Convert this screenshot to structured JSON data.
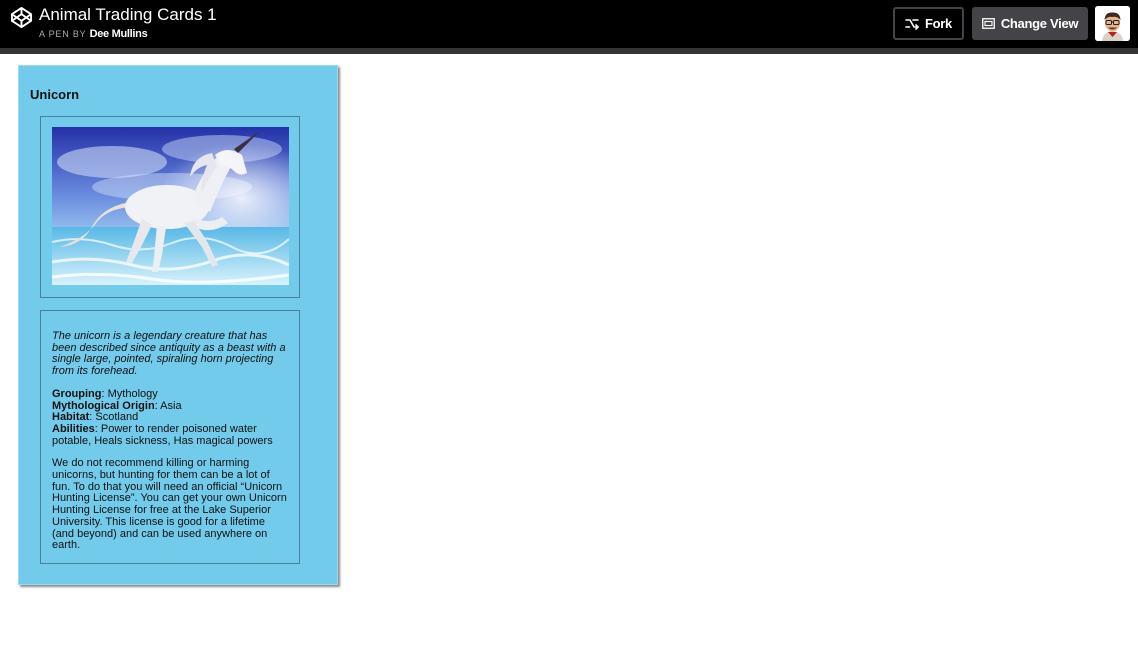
{
  "header": {
    "title": "Animal Trading Cards 1",
    "byline_prefix": "A PEN BY",
    "author": "Dee Mullins",
    "logo_icon": "codepen-logo-icon",
    "fork_label": "Fork",
    "fork_icon": "fork-icon",
    "change_view_label": "Change View",
    "change_view_icon": "layout-icon",
    "avatar_icon": "user-avatar"
  },
  "card": {
    "title": "Unicorn",
    "image_icon": "unicorn-photo",
    "intro": "The unicorn is a legendary creature that has been described since antiquity as a beast with a single large, pointed, spiraling horn projecting from its forehead.",
    "facts": [
      {
        "label": "Grouping",
        "value": ": Mythology"
      },
      {
        "label": "Mythological Origin",
        "value": ": Asia"
      },
      {
        "label": "Habitat",
        "value": ": Scotland"
      },
      {
        "label": "Abilities",
        "value": ": Power to render poisoned water potable, Heals sickness, Has magical powers"
      }
    ],
    "closing": "We do not recommend killing or harming unicorns, but hunting for them can be a lot of fun. To do that you will need an official “Unicorn Hunting License”. You can get your own Unicorn Hunting License for free at the Lake Superior University. This license is good for a lifetime (and beyond) and can be used anywhere on earth."
  },
  "colors": {
    "topbar": "#000000",
    "card_background": "#73cbec",
    "button_gray": "#444448"
  }
}
